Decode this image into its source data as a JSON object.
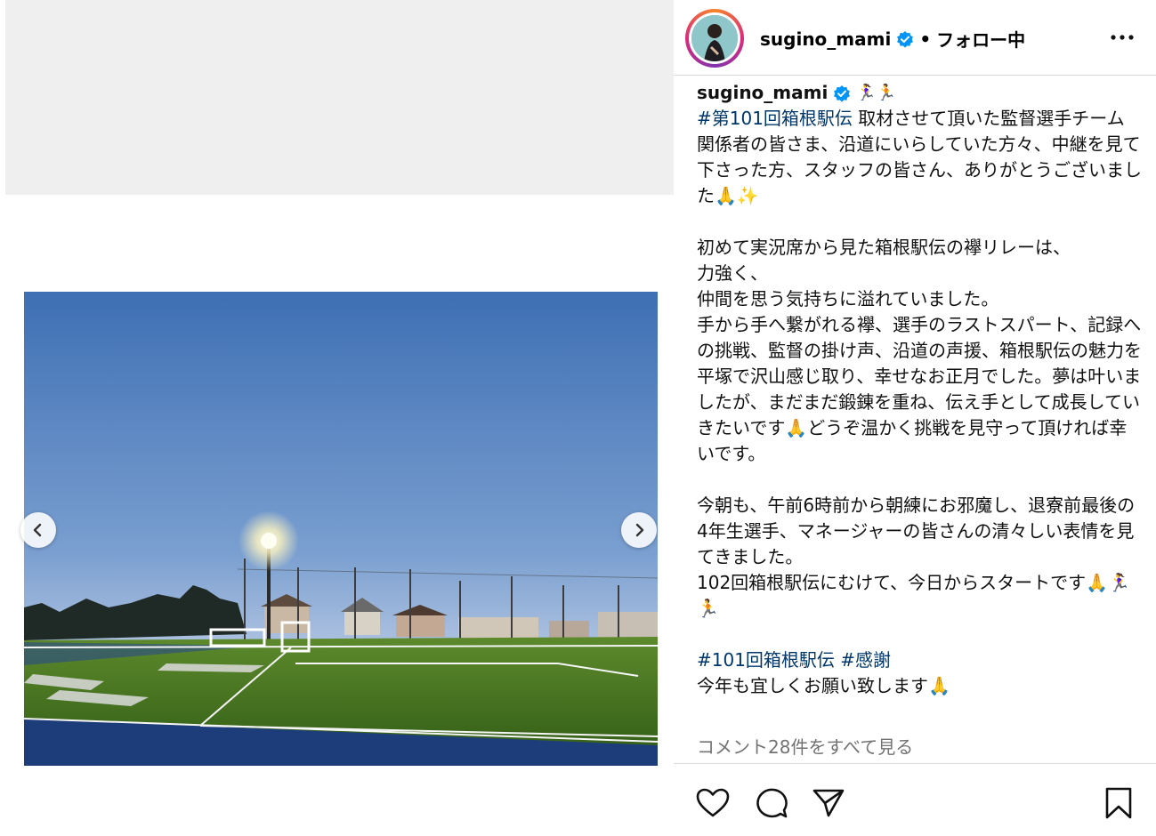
{
  "post": {
    "username": "sugino_mami",
    "follow_status": "フォロー中",
    "separator": "•",
    "caption_emoji_runner": "🏃‍♀️🏃",
    "caption_lines": [
      {
        "hashtag": "#第101回箱根駅伝",
        "text": " 取材させて頂いた監督選手チーム関係者の皆さま、沿道にいらしていた方々、中継を見て下さった方、スタッフの皆さん、ありがとうございました🙏✨"
      },
      {
        "text": ""
      },
      {
        "text": "初めて実況席から見た箱根駅伝の襷リレーは、\n力強く、\n仲間を思う気持ちに溢れていました。\n手から手へ繋がれる襷、選手のラストスパート、記録への挑戦、監督の掛け声、沿道の声援、箱根駅伝の魅力を平塚で沢山感じ取り、幸せなお正月でした。夢は叶いましたが、まだまだ鍛錬を重ね、伝え手として成長していきたいです🙏どうぞ温かく挑戦を見守って頂ければ幸いです。"
      },
      {
        "text": ""
      },
      {
        "text": "今朝も、午前6時前から朝練にお邪魔し、退寮前最後の4年生選手、マネージャーの皆さんの清々しい表情を見てきました。\n102回箱根駅伝にむけて、今日からスタートです🙏🏃‍♀️🏃"
      },
      {
        "text": ""
      }
    ],
    "hashtags_line": [
      "#101回箱根駅伝",
      "#感謝"
    ],
    "closing_line": "今年も宜しくお願い致します🙏",
    "comments_link": "コメント28件をすべて見る"
  },
  "icons": {
    "more": "more-horizontal-icon",
    "verified": "verified-badge-icon",
    "prev": "chevron-left-icon",
    "next": "chevron-right-icon",
    "like": "heart-icon",
    "comment": "comment-bubble-icon",
    "share": "paper-plane-icon",
    "save": "bookmark-icon"
  },
  "colors": {
    "verified": "#0095f6",
    "hashtag": "#00376b",
    "muted": "#737373"
  }
}
